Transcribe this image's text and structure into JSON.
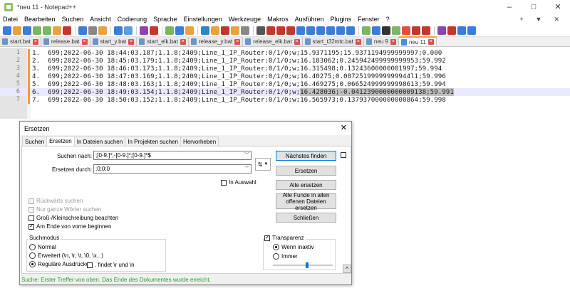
{
  "window": {
    "title": "*neu 11 - Notepad++",
    "controls": [
      "–",
      "□",
      "✕"
    ]
  },
  "menu": {
    "items": [
      "Datei",
      "Bearbeiten",
      "Suchen",
      "Ansicht",
      "Codierung",
      "Sprache",
      "Einstellungen",
      "Werkzeuge",
      "Makros",
      "Ausführen",
      "Plugins",
      "Fenster",
      "?"
    ],
    "right": [
      "+",
      "▼",
      "✕"
    ]
  },
  "tabs": [
    {
      "label": "start.bat",
      "active": false
    },
    {
      "label": "release.bat",
      "active": false
    },
    {
      "label": "start_y.bat",
      "active": false
    },
    {
      "label": "start_elk.bat",
      "active": false
    },
    {
      "label": "release_y.bat",
      "active": false
    },
    {
      "label": "release_elk.bat",
      "active": false
    },
    {
      "label": "start_t32mtc.bat",
      "active": false
    },
    {
      "label": "neu 9",
      "active": false
    },
    {
      "label": "neu 11",
      "active": true
    }
  ],
  "editor": {
    "lines": [
      {
        "num": "1",
        "text": "1.  699;2022-06-30 18:44:03.187;1.1.8;2409;Line_1_IP_Router:0/1/0;w;15.9371195;15.9371194999999997;0.000"
      },
      {
        "num": "2",
        "text": "2.  699;2022-06-30 18:45:03.179;1.1.8;2409;Line_1_IP_Router:0/1/0;w;16.183062;0.245942499999999953;59.992"
      },
      {
        "num": "3",
        "text": "3.  699;2022-06-30 18:46:03.173;1.1.8;2409;Line_1_IP_Router:0/1/0;w;16.315498;0.13243600000001997;59.994"
      },
      {
        "num": "4",
        "text": "4.  699;2022-06-30 18:47:03.169;1.1.8;2409;Line_1_IP_Router:0/1/0;w;16.40275;0.08725199999999944l1;59.996"
      },
      {
        "num": "5",
        "text": "5.  699;2022-06-30 18:48:03.163;1.1.8;2409;Line_1_IP_Router:0/1/0;w;16.469275;0.066524999999998613;59.994"
      },
      {
        "num": "6",
        "text": "6.  699;2022-06-30 18:49:03.154;1.1.8;2409;Line_1_IP_Router:0/1/0;w;",
        "selected": "16.428036;-0.0412390000000009138;59.991"
      },
      {
        "num": "7",
        "text": "7.  699;2022-06-30 18:50:03.152;1.1.8;2409;Line_1_IP_Router:0/1/0;w;16.565973;0.137937000000000864;59.998"
      }
    ]
  },
  "dialog": {
    "title": "Ersetzen",
    "close": "✕",
    "tabs": [
      "Suchen",
      "Ersetzen",
      "In Dateien suchen",
      "In Projekten suchen",
      "Hervorheben"
    ],
    "search_label": "Suchen nach:",
    "search_value": ";[0-9.]*;-[0-9.]*;[0-9.]*$",
    "replace_label": "Ersetzen durch:",
    "replace_value": ";0;0;0",
    "swap": "⇅",
    "in_selection": "In Auswahl",
    "buttons": {
      "find_next": "Nächstes finden",
      "replace": "Ersetzen",
      "replace_all": "Alle ersetzen",
      "replace_all_open": "Alle Funde in allen offenen Dateien ersetzen",
      "close": "Schließen"
    },
    "options": {
      "backward": "Rückwärts suchen",
      "whole_word": "Nur ganze Wörter suchen",
      "match_case": "Groß-/Kleinschreibung beachten",
      "wrap": "Am Ende von vorne beginnen"
    },
    "mode": {
      "title": "Suchmodus",
      "normal": "Normal",
      "extended": "Erweitert (\\n, \\r, \\t, \\0, \\x...)",
      "regex": "Reguläre Ausdrücke",
      "dot_newline": ". findet \\r und \\n"
    },
    "transparency": {
      "title": "Transparenz",
      "inactive": "Wenn inaktiv",
      "always": "Immer",
      "level": 0.55
    },
    "collapse": "^",
    "status": "Suche: Erster Treffer von oben. Das Ende des Dokumentes wurde erreicht."
  },
  "colors": {
    "toolbar_icons": [
      "#3b7dd8",
      "#e8a33d",
      "#3b7dd8",
      "#7bb661",
      "#7bb661",
      "#e8a33d",
      "#c0392b",
      "#3b7dd8",
      "#888",
      "#e8a33d",
      "#3b7dd8",
      "#5aa0e0",
      "#8e44ad",
      "#c0392b",
      "#7bb661",
      "#3b7dd8",
      "#e8a33d",
      "#2e86c1",
      "#e8a33d",
      "#c0392b",
      "#e8a33d",
      "#888",
      "#555",
      "#c0392b",
      "#c0392b",
      "#c0392b",
      "#3b7dd8",
      "#3b7dd8",
      "#3b7dd8",
      "#3b7dd8",
      "#3b7dd8",
      "#3b7dd8",
      "#7bb661",
      "#3b7dd8",
      "#333",
      "#7bb661",
      "#e74c3c",
      "#c0392b",
      "#c0392b",
      "#8e44ad",
      "#c0392b",
      "#3b7dd8",
      "#3b7dd8"
    ]
  }
}
